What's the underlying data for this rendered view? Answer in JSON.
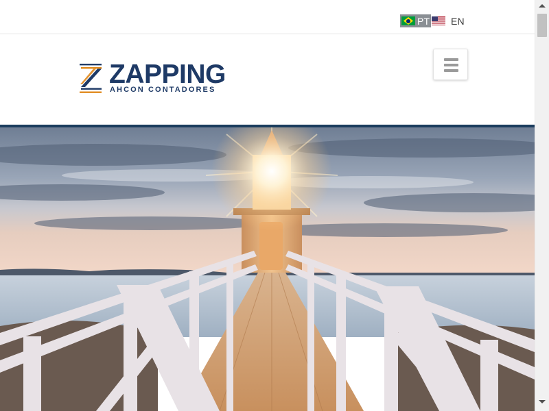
{
  "language_bar": {
    "pt_label": "PT",
    "en_label": "EN",
    "pt_flag_icon": "brazil-flag-icon",
    "en_flag_icon": "usa-flag-icon",
    "pt_active": true
  },
  "logo": {
    "wordmark": "ZAPPING",
    "tagline": "AHCON CONTADORES",
    "brand_color": "#1e3a66",
    "accent_color": "#e08a1e"
  },
  "menu": {
    "icon": "hamburger-menu-icon"
  },
  "hero": {
    "image": "lighthouse-pier-at-sunset",
    "divider_color": "#1b3d5e"
  }
}
